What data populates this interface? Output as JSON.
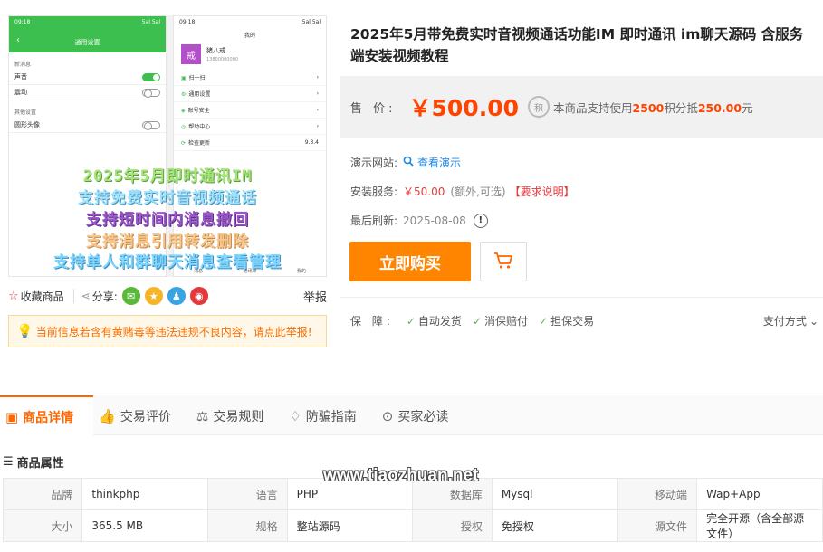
{
  "preview": {
    "left_phone": {
      "status_time": "09:18",
      "status_right": "5al 5al",
      "title": "通用设置",
      "section1": "新消息",
      "row_sound": "声音",
      "row_vibrate": "震动",
      "section2": "其他设置",
      "row_avatar": "圆形头像"
    },
    "right_phone": {
      "status_time": "09:18",
      "status_right": "5al 5al",
      "title": "我的",
      "avatar_char": "戒",
      "nickname": "猪八戒",
      "uid": "13800000000",
      "menu": [
        "扫一扫",
        "通用设置",
        "账号安全",
        "帮助中心",
        "检查更新"
      ],
      "version": "9.3.4",
      "tabs": [
        "消息",
        "通讯录",
        "我的"
      ]
    },
    "promo_lines": [
      "2025年5月即时通讯IM",
      "支持免费实时音视频通话",
      "支持短时间内消息撤回",
      "支持消息引用转发删除",
      "支持单人和群聊天消息查看管理"
    ]
  },
  "share": {
    "fav_label": "收藏商品",
    "share_label": "分享:",
    "report_label": "举报",
    "icons": [
      "wechat-icon",
      "star-icon",
      "qq-icon",
      "weibo-icon"
    ],
    "colors": {
      "wechat": "#5ab93b",
      "star": "#f5b528",
      "qq": "#3aa3e3",
      "weibo": "#e4393c"
    }
  },
  "notice": "当前信息若含有黄赌毒等违法违规不良内容，请点此举报!",
  "product": {
    "title": "2025年5月带免费实时音视频通话功能IM 即时通讯 im聊天源码 含服务端安装视频教程",
    "price_label": "售  价:",
    "price": "￥500.00",
    "points_icon": "积",
    "points_prefix": "本商品支持使用",
    "points_amount": "2500",
    "points_mid": "积分抵",
    "points_value": "250.00",
    "points_suffix": "元",
    "demo_label": "演示网站:",
    "demo_link": "查看演示",
    "install_label": "安装服务:",
    "install_price": "￥50.00",
    "install_note": "(额外,可选)",
    "install_req": "【要求说明】",
    "refresh_label": "最后刷新:",
    "refresh_date": "2025-08-08",
    "buy_label": "立即购买",
    "guarantee_label": "保  障:",
    "guarantees": [
      "自动发货",
      "消保赔付",
      "担保交易"
    ],
    "pay_label": "支付方式"
  },
  "tabs": [
    {
      "label": "商品详情",
      "icon": "shop-bag-icon"
    },
    {
      "label": "交易评价",
      "icon": "thumbs-up-icon"
    },
    {
      "label": "交易规则",
      "icon": "scale-icon"
    },
    {
      "label": "防骗指南",
      "icon": "lightbulb-icon"
    },
    {
      "label": "买家必读",
      "icon": "compass-icon"
    }
  ],
  "attributes": {
    "title": "商品属性",
    "rows": [
      [
        [
          "品牌",
          "thinkphp"
        ],
        [
          "语言",
          "PHP"
        ],
        [
          "数据库",
          "Mysql"
        ],
        [
          "移动端",
          "Wap+App"
        ]
      ],
      [
        [
          "大小",
          "365.5 MB"
        ],
        [
          "规格",
          "整站源码"
        ],
        [
          "授权",
          "免授权"
        ],
        [
          "源文件",
          "完全开源（含全部源文件）"
        ]
      ]
    ]
  },
  "watermark": "www.tiaozhuan.net",
  "colors": {
    "accent": "#ff6600",
    "price": "#ff4400",
    "buy": "#ff8400",
    "link": "#1e88e5",
    "green": "#3cbf4e"
  }
}
